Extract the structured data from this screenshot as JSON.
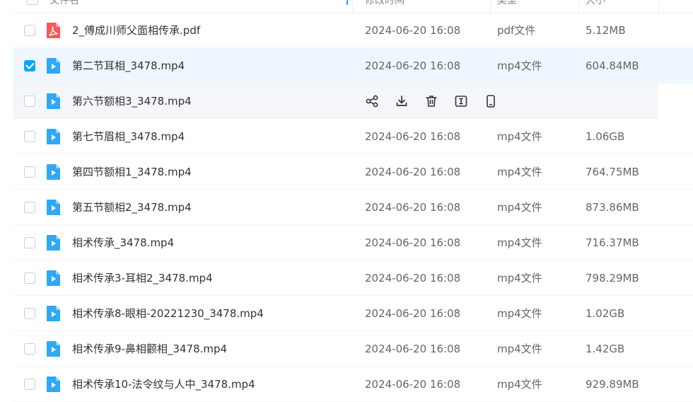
{
  "header": {
    "name": "文件名",
    "modified": "修改时间",
    "type": "类型",
    "size": "大小"
  },
  "rows": [
    {
      "name": "2_傅成川师父面相传承.pdf",
      "date": "2024-06-20 16:08",
      "type": "pdf文件",
      "size": "5.12MB",
      "icon": "pdf-icon"
    },
    {
      "name": "第二节耳相_3478.mp4",
      "date": "2024-06-20 16:08",
      "type": "mp4文件",
      "size": "604.84MB",
      "icon": "video-icon",
      "selected": true
    },
    {
      "name": "第六节额相3_3478.mp4",
      "date": "",
      "type": "",
      "size": "",
      "icon": "video-icon",
      "hovered": true
    },
    {
      "name": "第七节眉相_3478.mp4",
      "date": "2024-06-20 16:08",
      "type": "mp4文件",
      "size": "1.06GB",
      "icon": "video-icon"
    },
    {
      "name": "第四节额相1_3478.mp4",
      "date": "2024-06-20 16:08",
      "type": "mp4文件",
      "size": "764.75MB",
      "icon": "video-icon"
    },
    {
      "name": "第五节额相2_3478.mp4",
      "date": "2024-06-20 16:08",
      "type": "mp4文件",
      "size": "873.86MB",
      "icon": "video-icon"
    },
    {
      "name": "相术传承_3478.mp4",
      "date": "2024-06-20 16:08",
      "type": "mp4文件",
      "size": "716.37MB",
      "icon": "video-icon"
    },
    {
      "name": "相术传承3-耳相2_3478.mp4",
      "date": "2024-06-20 16:08",
      "type": "mp4文件",
      "size": "798.29MB",
      "icon": "video-icon"
    },
    {
      "name": "相术传承8-眼相-20221230_3478.mp4",
      "date": "2024-06-20 16:08",
      "type": "mp4文件",
      "size": "1.02GB",
      "icon": "video-icon"
    },
    {
      "name": "相术传承9-鼻相颧相_3478.mp4",
      "date": "2024-06-20 16:08",
      "type": "mp4文件",
      "size": "1.42GB",
      "icon": "video-icon"
    },
    {
      "name": "相术传承10-法令纹与人中_3478.mp4",
      "date": "2024-06-20 16:08",
      "type": "mp4文件",
      "size": "929.89MB",
      "icon": "video-icon"
    }
  ],
  "hover_actions": [
    "share-icon",
    "download-icon",
    "delete-icon",
    "rename-icon",
    "phone-icon"
  ],
  "colors": {
    "accent": "#06a7ff",
    "pdf": "#f5595a",
    "video": "#2ea8f7",
    "selected_bg": "#eef7ff"
  }
}
